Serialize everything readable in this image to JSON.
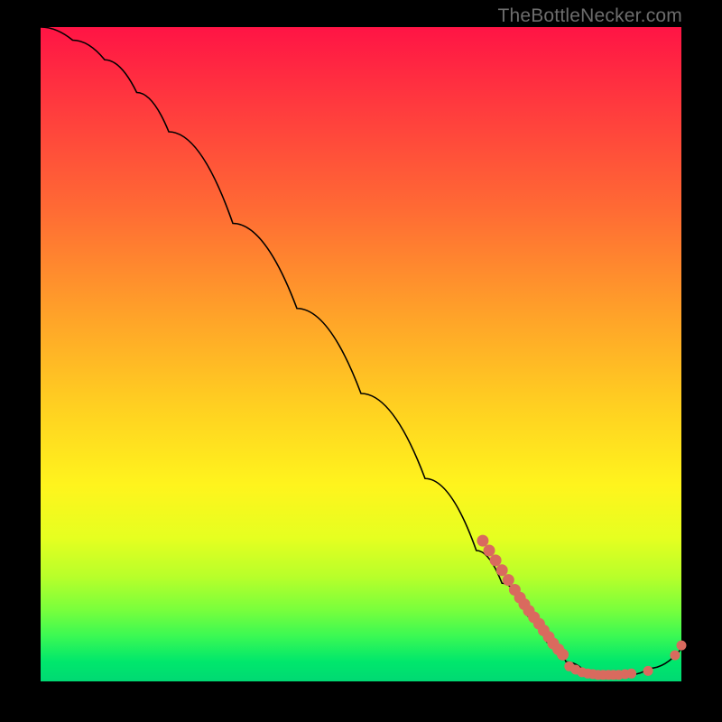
{
  "watermark": "TheBottleNecker.com",
  "chart_data": {
    "type": "line",
    "title": "",
    "xlabel": "",
    "ylabel": "",
    "xlim": [
      0,
      100
    ],
    "ylim": [
      0,
      100
    ],
    "series": [
      {
        "name": "curve",
        "x": [
          0,
          5,
          10,
          15,
          20,
          30,
          40,
          50,
          60,
          68,
          72,
          76,
          79,
          82,
          85,
          88,
          90,
          92,
          95,
          100
        ],
        "values": [
          100,
          98,
          95,
          90,
          84,
          70,
          57,
          44,
          31,
          20,
          15,
          10,
          6,
          3,
          1.5,
          1,
          1,
          1,
          2,
          5
        ]
      }
    ],
    "scatter": [
      {
        "name": "dense-slope",
        "points": [
          {
            "x": 69,
            "y": 21.5
          },
          {
            "x": 70,
            "y": 20
          },
          {
            "x": 71,
            "y": 18.5
          },
          {
            "x": 72,
            "y": 17
          },
          {
            "x": 73,
            "y": 15.5
          },
          {
            "x": 74,
            "y": 14
          },
          {
            "x": 74.8,
            "y": 12.8
          },
          {
            "x": 75.5,
            "y": 11.8
          },
          {
            "x": 76.2,
            "y": 10.8
          },
          {
            "x": 77,
            "y": 9.8
          },
          {
            "x": 77.8,
            "y": 8.8
          },
          {
            "x": 78.5,
            "y": 7.8
          },
          {
            "x": 79.3,
            "y": 6.8
          },
          {
            "x": 80,
            "y": 5.8
          },
          {
            "x": 80.8,
            "y": 4.9
          },
          {
            "x": 81.5,
            "y": 4.1
          }
        ]
      },
      {
        "name": "valley",
        "points": [
          {
            "x": 82.5,
            "y": 2.3
          },
          {
            "x": 83.5,
            "y": 1.8
          },
          {
            "x": 84.5,
            "y": 1.4
          },
          {
            "x": 85.4,
            "y": 1.2
          },
          {
            "x": 86.2,
            "y": 1.1
          },
          {
            "x": 87.0,
            "y": 1.0
          },
          {
            "x": 87.8,
            "y": 1.0
          },
          {
            "x": 88.6,
            "y": 1.0
          },
          {
            "x": 89.4,
            "y": 1.0
          },
          {
            "x": 90.2,
            "y": 1.0
          },
          {
            "x": 91.2,
            "y": 1.1
          },
          {
            "x": 92.2,
            "y": 1.2
          },
          {
            "x": 94.8,
            "y": 1.6
          }
        ]
      },
      {
        "name": "tail",
        "points": [
          {
            "x": 99.0,
            "y": 4.0
          },
          {
            "x": 100.0,
            "y": 5.5
          }
        ]
      }
    ],
    "colors": {
      "curve": "#000000",
      "dot": "#d96a5e",
      "bg_top": "#ff1445",
      "bg_bottom": "#00d973",
      "frame": "#000000"
    }
  }
}
